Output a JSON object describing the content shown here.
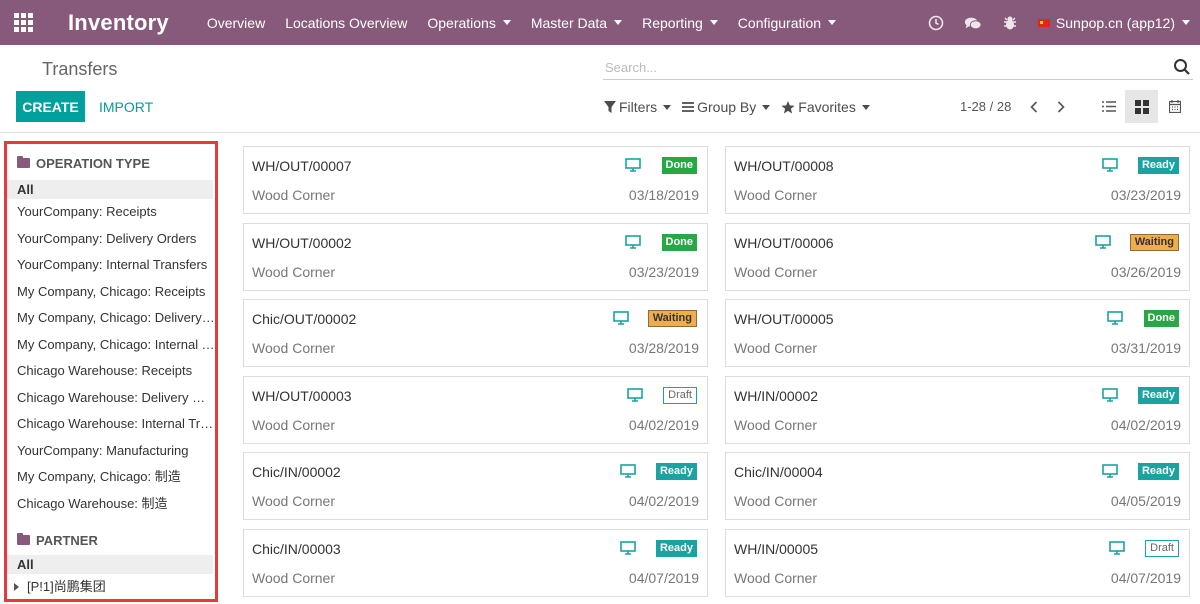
{
  "app": {
    "title": "Inventory",
    "menu": [
      {
        "label": "Overview",
        "dropdown": false
      },
      {
        "label": "Locations Overview",
        "dropdown": false
      },
      {
        "label": "Operations",
        "dropdown": true
      },
      {
        "label": "Master Data",
        "dropdown": true
      },
      {
        "label": "Reporting",
        "dropdown": true
      },
      {
        "label": "Configuration",
        "dropdown": true
      }
    ],
    "company": "Sunpop.cn (app12)"
  },
  "control": {
    "breadcrumb": "Transfers",
    "search_placeholder": "Search...",
    "create_label": "CREATE",
    "import_label": "IMPORT",
    "filters_label": "Filters",
    "groupby_label": "Group By",
    "favorites_label": "Favorites",
    "pager": "1-28 / 28"
  },
  "sidebar": {
    "operation_type_title": "OPERATION TYPE",
    "operation_types": [
      "All",
      "YourCompany: Receipts",
      "YourCompany: Delivery Orders",
      "YourCompany: Internal Transfers",
      "My Company, Chicago: Receipts",
      "My Company, Chicago: Delivery Orders",
      "My Company, Chicago: Internal Transfers",
      "Chicago Warehouse: Receipts",
      "Chicago Warehouse: Delivery Orders",
      "Chicago Warehouse: Internal Transfers",
      "YourCompany: Manufacturing",
      "My Company, Chicago: 制造",
      "Chicago Warehouse: 制造"
    ],
    "partner_title": "PARTNER",
    "partner_all": "All",
    "partner_first": "[P!1]尚鹏集团"
  },
  "cards": [
    {
      "ref": "WH/OUT/00007",
      "partner": "Wood Corner",
      "date": "03/18/2019",
      "state": "Done"
    },
    {
      "ref": "WH/OUT/00008",
      "partner": "Wood Corner",
      "date": "03/23/2019",
      "state": "Ready"
    },
    {
      "ref": "WH/OUT/00002",
      "partner": "Wood Corner",
      "date": "03/23/2019",
      "state": "Done"
    },
    {
      "ref": "WH/OUT/00006",
      "partner": "Wood Corner",
      "date": "03/26/2019",
      "state": "Waiting"
    },
    {
      "ref": "Chic/OUT/00002",
      "partner": "Wood Corner",
      "date": "03/28/2019",
      "state": "Waiting"
    },
    {
      "ref": "WH/OUT/00005",
      "partner": "Wood Corner",
      "date": "03/31/2019",
      "state": "Done"
    },
    {
      "ref": "WH/OUT/00003",
      "partner": "Wood Corner",
      "date": "04/02/2019",
      "state": "Draft"
    },
    {
      "ref": "WH/IN/00002",
      "partner": "Wood Corner",
      "date": "04/02/2019",
      "state": "Ready"
    },
    {
      "ref": "Chic/IN/00002",
      "partner": "Wood Corner",
      "date": "04/02/2019",
      "state": "Ready"
    },
    {
      "ref": "Chic/IN/00004",
      "partner": "Wood Corner",
      "date": "04/05/2019",
      "state": "Ready"
    },
    {
      "ref": "Chic/IN/00003",
      "partner": "Wood Corner",
      "date": "04/07/2019",
      "state": "Ready"
    },
    {
      "ref": "WH/IN/00005",
      "partner": "Wood Corner",
      "date": "04/07/2019",
      "state": "Draft"
    }
  ],
  "colors": {
    "navbar": "#875a7b",
    "primary": "#00a09d",
    "done": "#28a745",
    "ready": "#1aa3a0",
    "waiting": "#f0ad4e",
    "highlight_border": "#e8393b"
  },
  "icons": {
    "apps": "apps-grid-icon",
    "clock": "clock-icon",
    "chat": "chat-icon",
    "debug": "bug-icon",
    "search": "search-icon",
    "filter": "filter-icon",
    "groupby": "list-icon",
    "favorites": "star-icon",
    "card_device": "monitor-icon"
  }
}
